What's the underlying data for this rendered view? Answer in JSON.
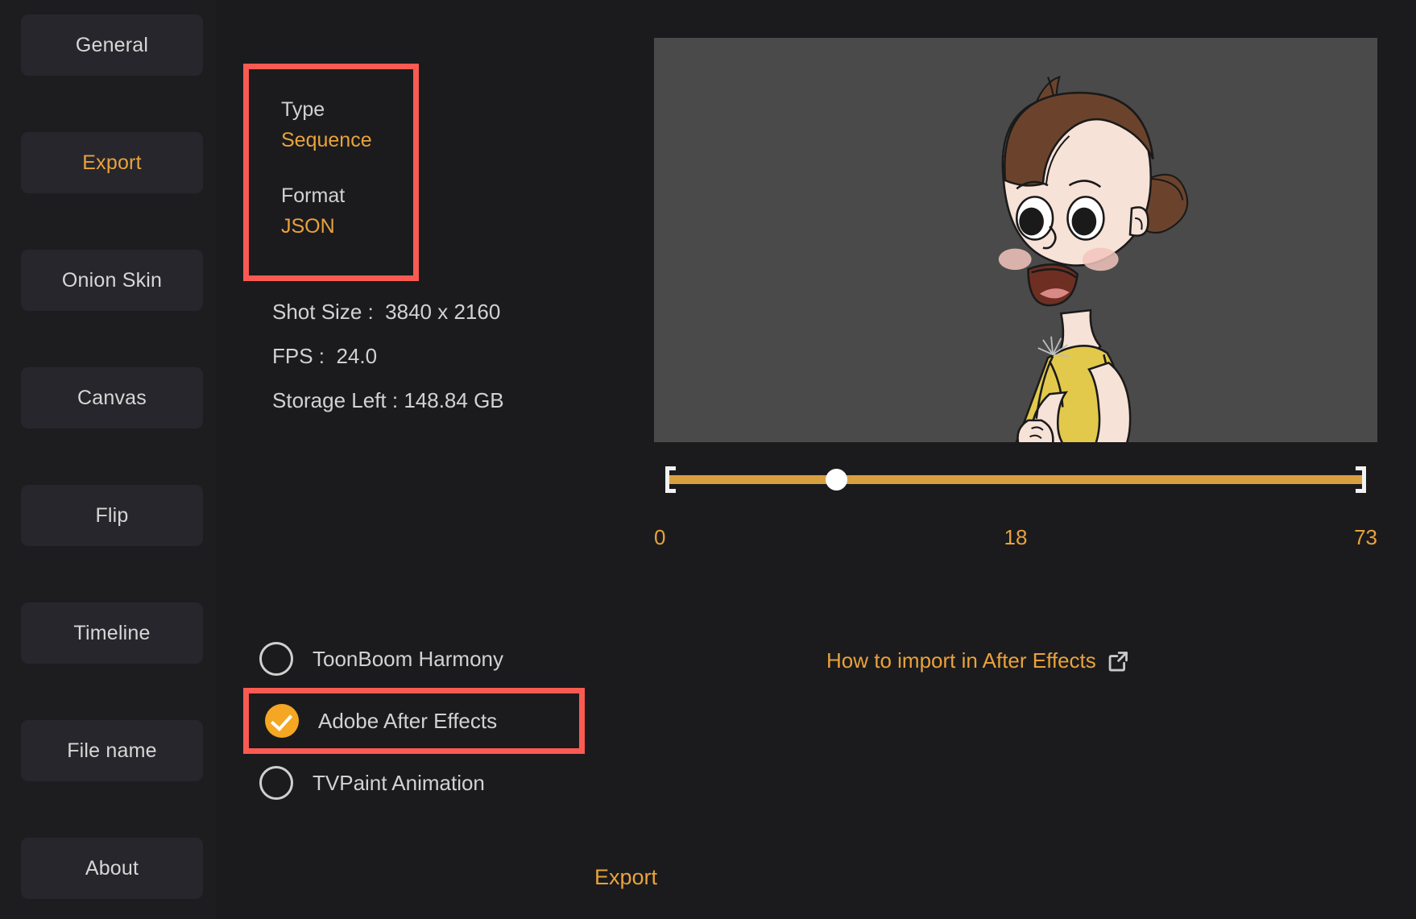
{
  "sidebar": {
    "items": [
      {
        "label": "General",
        "active": false
      },
      {
        "label": "Export",
        "active": true
      },
      {
        "label": "Onion Skin",
        "active": false
      },
      {
        "label": "Canvas",
        "active": false
      },
      {
        "label": "Flip",
        "active": false
      },
      {
        "label": "Timeline",
        "active": false
      },
      {
        "label": "File name",
        "active": false
      },
      {
        "label": "About",
        "active": false
      }
    ]
  },
  "export_settings": {
    "type_label": "Type",
    "type_value": "Sequence",
    "format_label": "Format",
    "format_value": "JSON",
    "info": [
      "Shot Size :  3840 x 2160",
      "FPS :  24.0",
      "Storage Left : 148.84 GB"
    ],
    "shot_size": "3840 x 2160",
    "fps": "24.0",
    "storage_left": "148.84 GB"
  },
  "targets": {
    "options": [
      {
        "label": "ToonBoom Harmony",
        "selected": false
      },
      {
        "label": "Adobe After Effects",
        "selected": true
      },
      {
        "label": "TVPaint Animation",
        "selected": false
      }
    ]
  },
  "preview": {
    "timeline": {
      "start_frame": "0",
      "current_frame": "18",
      "end_frame": "73",
      "handle_percent": 24
    },
    "import_link": {
      "label": "How to import in After Effects",
      "icon": "external-link-icon"
    }
  },
  "actions": {
    "export_label": "Export"
  },
  "colors": {
    "accent": "#e9a23c",
    "highlight": "#fb5a52",
    "selected_radio": "#f5a623",
    "panel": "#26262c",
    "background": "#1b1b1d",
    "canvas": "#4a4a4a"
  }
}
